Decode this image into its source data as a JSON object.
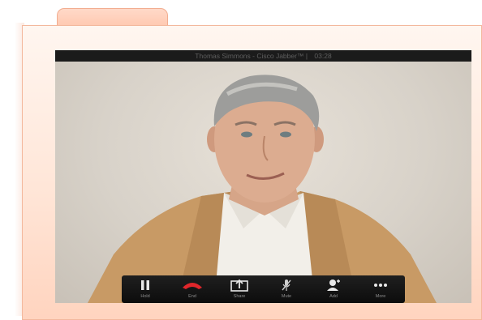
{
  "window": {
    "title": "Thomas Simmons - Cisco Jabber™",
    "separator": "|",
    "timer": "03:28"
  },
  "controls": [
    {
      "name": "hold",
      "label": "Hold",
      "icon": "pause-icon"
    },
    {
      "name": "end",
      "label": "End",
      "icon": "hangup-icon"
    },
    {
      "name": "share",
      "label": "Share",
      "icon": "share-screen-icon"
    },
    {
      "name": "mute",
      "label": "Mute",
      "icon": "microphone-muted-icon"
    },
    {
      "name": "add",
      "label": "Add",
      "icon": "add-participant-icon"
    },
    {
      "name": "more",
      "label": "More",
      "icon": "ellipsis-icon"
    }
  ],
  "colors": {
    "end_call_red": "#e0262b",
    "folder_border": "#f3b89d",
    "titlebar_bg": "#1b1b1b"
  }
}
